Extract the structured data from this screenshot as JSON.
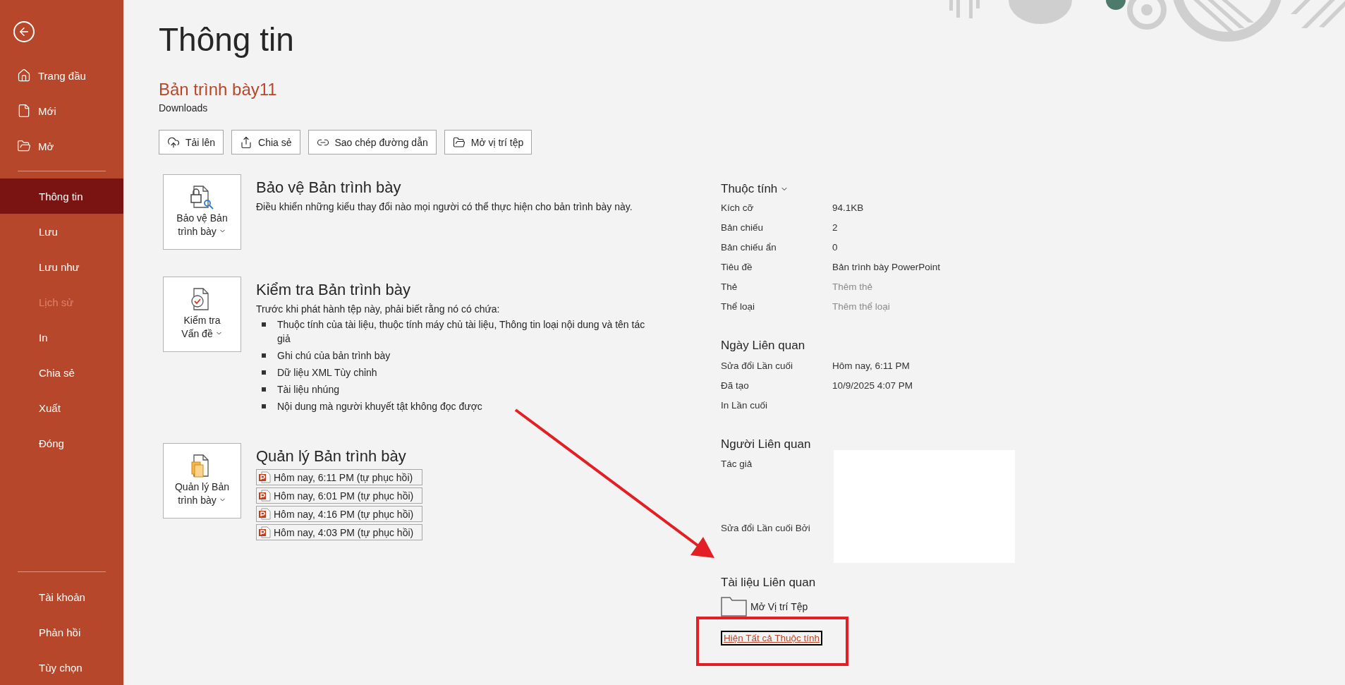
{
  "sidebar": {
    "top_items": [
      {
        "label": "Trang đầu",
        "selected": false,
        "disabled": false
      },
      {
        "label": "Mới",
        "selected": false,
        "disabled": false
      },
      {
        "label": "Mở",
        "selected": false,
        "disabled": false
      }
    ],
    "items": [
      {
        "label": "Thông tin",
        "selected": true,
        "disabled": false
      },
      {
        "label": "Lưu",
        "selected": false,
        "disabled": false
      },
      {
        "label": "Lưu như",
        "selected": false,
        "disabled": false
      },
      {
        "label": "Lịch sử",
        "selected": false,
        "disabled": true
      },
      {
        "label": "In",
        "selected": false,
        "disabled": false
      },
      {
        "label": "Chia sẻ",
        "selected": false,
        "disabled": false
      },
      {
        "label": "Xuất",
        "selected": false,
        "disabled": false
      },
      {
        "label": "Đóng",
        "selected": false,
        "disabled": false
      }
    ],
    "bottom_items": [
      {
        "label": "Tài khoản",
        "selected": false,
        "disabled": false
      },
      {
        "label": "Phản hồi",
        "selected": false,
        "disabled": false
      },
      {
        "label": "Tùy chọn",
        "selected": false,
        "disabled": false
      }
    ]
  },
  "page_title": "Thông tin",
  "document": {
    "name": "Bản trình bày11",
    "location": "Downloads"
  },
  "actions": [
    {
      "kind": "upload",
      "label": "Tải lên"
    },
    {
      "kind": "share",
      "label": "Chia sẻ"
    },
    {
      "kind": "link",
      "label": "Sao chép đường dẫn"
    },
    {
      "kind": "folder",
      "label": "Mở vị trí tệp"
    }
  ],
  "sections": [
    {
      "kind": "protect",
      "button": "Bảo vệ Bản trình bày",
      "heading": "Bảo vệ Bản trình bày",
      "description": "Điều khiển những kiểu thay đổi nào mọi người có thể thực hiện cho bản trình bày này."
    },
    {
      "kind": "inspect",
      "button": "Kiểm tra Vấn đề",
      "heading": "Kiểm tra Bản trình bày",
      "description": "Trước khi phát hành tệp này, phải biết rằng nó có chứa:",
      "bullets": [
        "Thuộc tính của tài liệu, thuộc tính máy chủ tài liệu, Thông tin loại nội dung và tên tác giả",
        "Ghi chú của bản trình bày",
        "Dữ liệu XML Tùy chỉnh",
        "Tài liệu nhúng",
        "Nội dung mà người khuyết tật không đọc được"
      ]
    },
    {
      "kind": "manage",
      "button": "Quản lý Bản trình bày",
      "heading": "Quản lý Bản trình bày",
      "versions": [
        "Hôm nay, 6:11 PM (tự phục hồi)",
        "Hôm nay, 6:01 PM (tự phục hồi)",
        "Hôm nay, 4:16 PM (tự phục hồi)",
        "Hôm nay, 4:03 PM (tự phục hồi)"
      ]
    }
  ],
  "properties": {
    "heading": "Thuộc tính",
    "rows": [
      {
        "label": "Kích cỡ",
        "value": "94.1KB"
      },
      {
        "label": "Bản chiếu",
        "value": "2"
      },
      {
        "label": "Bản chiếu ẩn",
        "value": "0"
      },
      {
        "label": "Tiêu đề",
        "value": "Bản trình bày PowerPoint"
      },
      {
        "label": "Thẻ",
        "placeholder": "Thêm thẻ"
      },
      {
        "label": "Thể loại",
        "placeholder": "Thêm thể loại"
      }
    ]
  },
  "related_dates": {
    "heading": "Ngày Liên quan",
    "rows": [
      {
        "label": "Sửa đổi Lần cuối",
        "value": "Hôm nay, 6:11 PM"
      },
      {
        "label": "Đã tạo",
        "value": "10/9/2025 4:07 PM"
      },
      {
        "label": "In Lần cuối"
      }
    ]
  },
  "related_people": {
    "heading": "Người Liên quan",
    "rows": [
      {
        "label": "Tác giả"
      },
      {
        "label": "Sửa đổi Lần cuối Bởi"
      }
    ]
  },
  "related_documents": {
    "heading": "Tài liệu Liên quan",
    "open_location": "Mở Vị trí Tệp",
    "show_all_link": "Hiện Tất cả Thuộc tính"
  }
}
